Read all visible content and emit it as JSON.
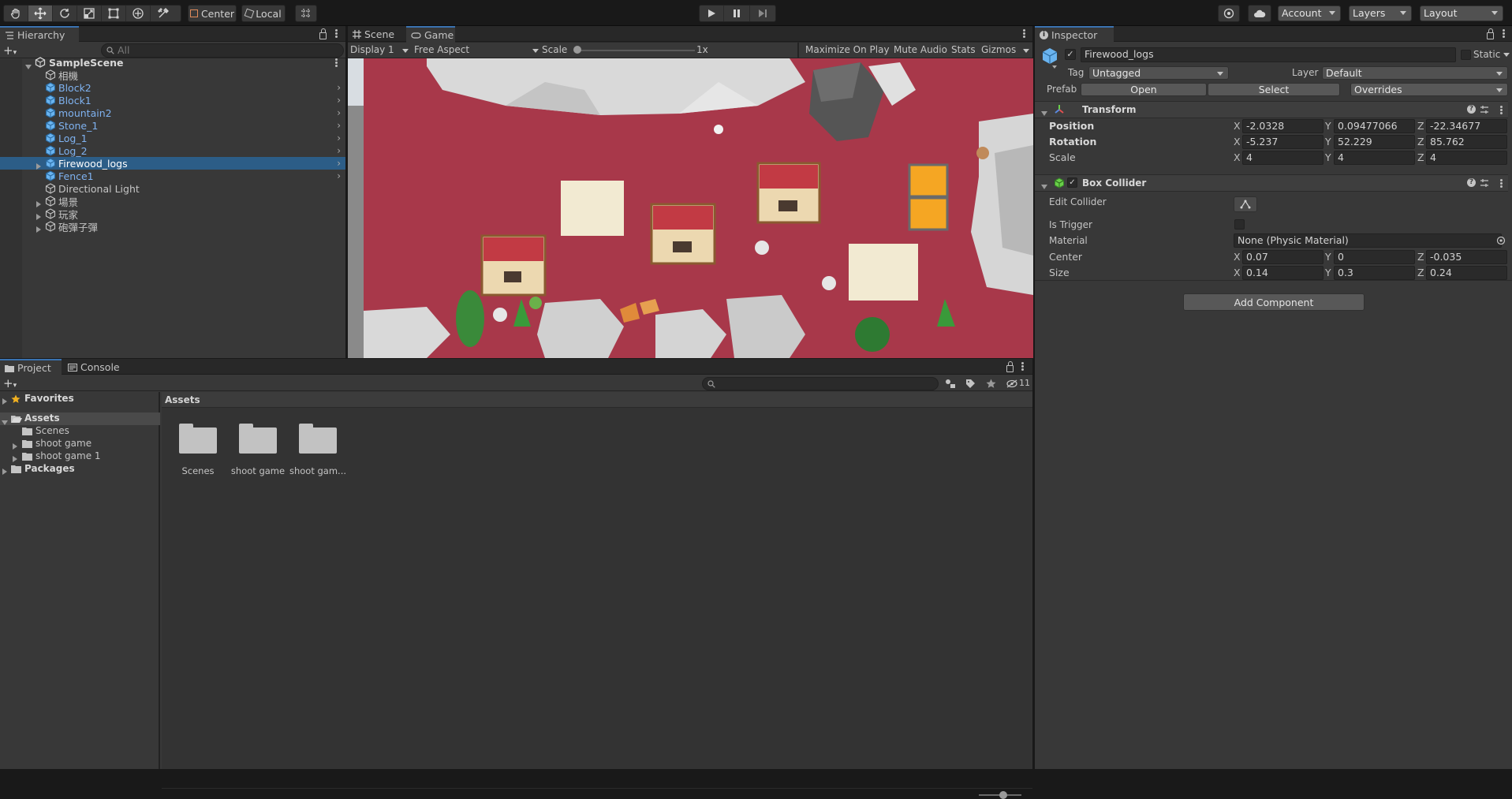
{
  "toolbar": {
    "center_label": "Center",
    "local_label": "Local",
    "account_label": "Account",
    "layers_label": "Layers",
    "layout_label": "Layout"
  },
  "hierarchy": {
    "tab_label": "Hierarchy",
    "search_placeholder": "All",
    "scene_name": "SampleScene",
    "items": [
      {
        "label": "相機",
        "blue": false,
        "expandable": false,
        "chevron": false
      },
      {
        "label": "Block2",
        "blue": true,
        "expandable": false,
        "chevron": true
      },
      {
        "label": "Block1",
        "blue": true,
        "expandable": false,
        "chevron": true
      },
      {
        "label": "mountain2",
        "blue": true,
        "expandable": false,
        "chevron": true
      },
      {
        "label": "Stone_1",
        "blue": true,
        "expandable": false,
        "chevron": true
      },
      {
        "label": "Log_1",
        "blue": true,
        "expandable": false,
        "chevron": true
      },
      {
        "label": "Log_2",
        "blue": true,
        "expandable": false,
        "chevron": true
      },
      {
        "label": "Firewood_logs",
        "blue": true,
        "expandable": true,
        "chevron": true,
        "selected": true
      },
      {
        "label": "Fence1",
        "blue": true,
        "expandable": false,
        "chevron": true
      },
      {
        "label": "Directional Light",
        "blue": false,
        "expandable": false,
        "chevron": false
      },
      {
        "label": "場景",
        "blue": false,
        "expandable": true,
        "chevron": false
      },
      {
        "label": "玩家",
        "blue": false,
        "expandable": true,
        "chevron": false
      },
      {
        "label": "砲彈子彈",
        "blue": false,
        "expandable": true,
        "chevron": false
      }
    ]
  },
  "game": {
    "scene_tab": "Scene",
    "game_tab": "Game",
    "display": "Display 1",
    "aspect": "Free Aspect",
    "scale_label": "Scale",
    "scale_value": "1x",
    "maximize": "Maximize On Play",
    "mute": "Mute Audio",
    "stats": "Stats",
    "gizmos": "Gizmos"
  },
  "inspector": {
    "tab_label": "Inspector",
    "object_name": "Firewood_logs",
    "static_label": "Static",
    "tag_label": "Tag",
    "tag_value": "Untagged",
    "layer_label": "Layer",
    "layer_value": "Default",
    "prefab_label": "Prefab",
    "open_label": "Open",
    "select_label": "Select",
    "overrides_label": "Overrides",
    "transform": {
      "title": "Transform",
      "position_label": "Position",
      "position": {
        "x": "-2.0328",
        "y": "0.09477066",
        "z": "-22.34677"
      },
      "rotation_label": "Rotation",
      "rotation": {
        "x": "-5.237",
        "y": "52.229",
        "z": "85.762"
      },
      "scale_label": "Scale",
      "scale": {
        "x": "4",
        "y": "4",
        "z": "4"
      }
    },
    "box_collider": {
      "title": "Box Collider",
      "edit_collider_label": "Edit Collider",
      "is_trigger_label": "Is Trigger",
      "material_label": "Material",
      "material_value": "None (Physic Material)",
      "center_label": "Center",
      "center": {
        "x": "0.07",
        "y": "0",
        "z": "-0.035"
      },
      "size_label": "Size",
      "size": {
        "x": "0.14",
        "y": "0.3",
        "z": "0.24"
      }
    },
    "add_component": "Add Component"
  },
  "project": {
    "project_tab": "Project",
    "console_tab": "Console",
    "hidden_count": "11",
    "tree": {
      "favorites": "Favorites",
      "assets": "Assets",
      "children": [
        "Scenes",
        "shoot game",
        "shoot game 1"
      ],
      "packages": "Packages"
    },
    "breadcrumb": "Assets",
    "folders": [
      "Scenes",
      "shoot game",
      "shoot gam..."
    ]
  },
  "axis_labels": {
    "x": "X",
    "y": "Y",
    "z": "Z"
  },
  "colors": {
    "selection": "#2c5d87",
    "prefab_blue": "#7fb2f0",
    "game_floor": "#a8384a"
  }
}
